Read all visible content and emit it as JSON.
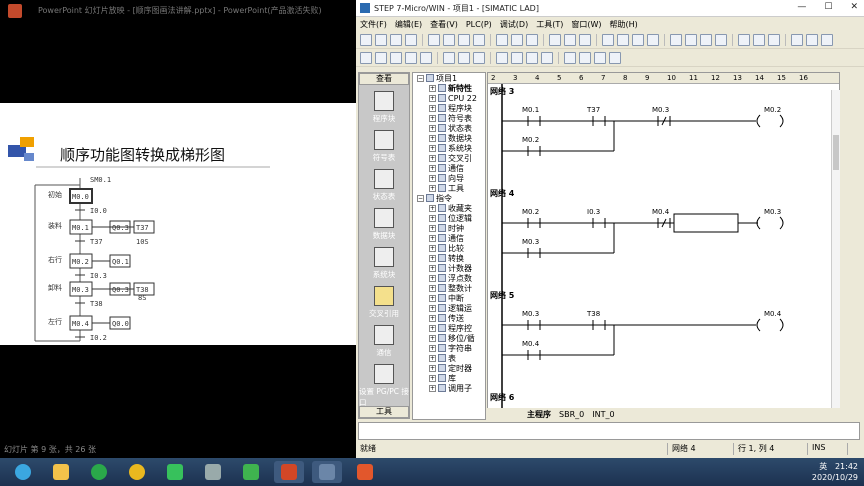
{
  "ppt": {
    "title": "PowerPoint 幻灯片放映 - [顺序图画法讲解.pptx] - PowerPoint(产品激活失败)",
    "slide_title": "顺序功能图转换成梯形图",
    "status": "幻灯片 第 9 张，共 26 张",
    "sfc": {
      "init": "SM0.1",
      "steps": [
        "M0.0",
        "M0.1",
        "M0.2",
        "M0.3",
        "M0.4"
      ],
      "step_labels": [
        "初始",
        "装料",
        "右行",
        "卸料",
        "左行"
      ],
      "transitions": [
        "I0.0",
        "T37",
        "I0.3",
        "T38",
        "I0.2"
      ],
      "actions": [
        "Q0.3",
        "T37",
        "Q0.1",
        "Q0.3",
        "T38",
        "Q0.0"
      ],
      "timer_values": [
        "10S",
        "8S"
      ]
    }
  },
  "win": {
    "title": "STEP 7-Micro/WIN - 项目1 - [SIMATIC LAD]",
    "menu": [
      "文件(F)",
      "编辑(E)",
      "查看(V)",
      "PLC(P)",
      "调试(D)",
      "工具(T)",
      "窗口(W)",
      "帮助(H)"
    ],
    "nav_head": "查看",
    "nav_items": [
      "程序块",
      "符号表",
      "状态表",
      "数据块",
      "系统块",
      "交叉引用",
      "通信",
      "设置 PG/PC 接口"
    ],
    "nav_foot": "工具",
    "tree": [
      "项目1",
      "新特性",
      "CPU 22",
      "程序块",
      "符号表",
      "状态表",
      "数据块",
      "系统块",
      "交叉引",
      "通信",
      "向导",
      "工具",
      "指令",
      "收藏夹",
      "位逻辑",
      "时钟",
      "通信",
      "比较",
      "转换",
      "计数器",
      "浮点数",
      "整数计",
      "中断",
      "逻辑运",
      "传送",
      "程序控",
      "移位/循",
      "字符串",
      "表",
      "定时器",
      "库",
      "调用子"
    ],
    "ruler": [
      "2",
      "3",
      "4",
      "5",
      "6",
      "7",
      "8",
      "9",
      "10",
      "11",
      "12",
      "13",
      "14",
      "15",
      "16"
    ],
    "networks": [
      {
        "title": "网络 3",
        "c1": "M0.1",
        "c2": "T37",
        "c3": "M0.3",
        "coil": "M0.2",
        "p": "M0.2"
      },
      {
        "title": "网络 4",
        "c1": "M0.2",
        "c2": "I0.3",
        "c3": "M0.4",
        "coil": "M0.3",
        "p": "M0.3"
      },
      {
        "title": "网络 5",
        "c1": "M0.3",
        "c2": "T38",
        "coil": "M0.4",
        "p": "M0.4"
      },
      {
        "title": "网络 6"
      }
    ],
    "tabs": [
      "主程序",
      "SBR_0",
      "INT_0"
    ],
    "status": {
      "ready": "就绪",
      "network": "网络 4",
      "pos": "行 1, 列 4",
      "mode": "INS"
    }
  },
  "tray": {
    "lang": "英",
    "time": "21:42",
    "date": "2020/10/29"
  },
  "colors": {
    "taskbar": "#1c3150",
    "slide_bg": "#ffffff",
    "accent": "#f0a000"
  }
}
